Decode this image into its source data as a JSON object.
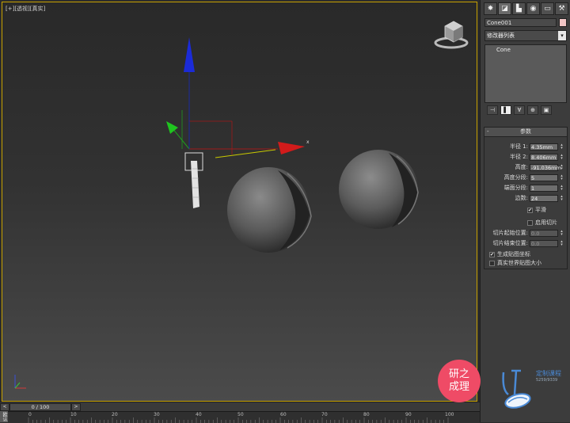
{
  "viewport": {
    "label": "[+][透视][真实]",
    "axis_label_x": "x"
  },
  "command_panel": {
    "tabs": [
      {
        "name": "create",
        "glyph": "✸"
      },
      {
        "name": "modify",
        "glyph": "◪"
      },
      {
        "name": "hierarchy",
        "glyph": "▙"
      },
      {
        "name": "motion",
        "glyph": "◉"
      },
      {
        "name": "display",
        "glyph": "▭"
      },
      {
        "name": "utilities",
        "glyph": "⚒"
      }
    ],
    "object_name": "Cone001",
    "object_color": "#f2c6c6",
    "modifier_list": "修改器列表",
    "modifier_list_arrow": "▾",
    "stack_items": [
      "Cone"
    ],
    "stack_tools": [
      "⊣",
      "▌",
      "∀",
      "⊕",
      "▣"
    ]
  },
  "parameters": {
    "title": "参数",
    "collapse": "-",
    "fields": [
      {
        "label": "半径 1:",
        "value": "4.35mm",
        "enabled": true
      },
      {
        "label": "半径 2:",
        "value": "8.406mm",
        "enabled": true
      },
      {
        "label": "高度:",
        "value": "-91.036mm",
        "enabled": true
      },
      {
        "label": "高度分段:",
        "value": "5",
        "enabled": true
      },
      {
        "label": "端面分段:",
        "value": "1",
        "enabled": true
      },
      {
        "label": "边数:",
        "value": "24",
        "enabled": true
      }
    ],
    "smooth_label": "平滑",
    "smooth_checked": true,
    "slice_on_label": "启用切片",
    "slice_on_checked": false,
    "slice_fields": [
      {
        "label": "切片起始位置:",
        "value": "0.0",
        "enabled": false
      },
      {
        "label": "切片结束位置:",
        "value": "0.0",
        "enabled": false
      }
    ],
    "gen_mapping_label": "生成贴图坐标",
    "gen_mapping_checked": true,
    "real_world_label": "真实世界贴图大小",
    "real_world_checked": false
  },
  "timeline": {
    "prev": "<",
    "frame_label": "0 / 100",
    "next": ">",
    "ticks": [
      "0",
      "10",
      "20",
      "30",
      "40",
      "50",
      "60",
      "70",
      "80",
      "90",
      "100"
    ],
    "side_label": "欧认"
  },
  "watermark": {
    "badge_line1": "研之",
    "badge_line2": "成理",
    "logo_text": "定制课程",
    "logo_number": "5259/9339"
  }
}
